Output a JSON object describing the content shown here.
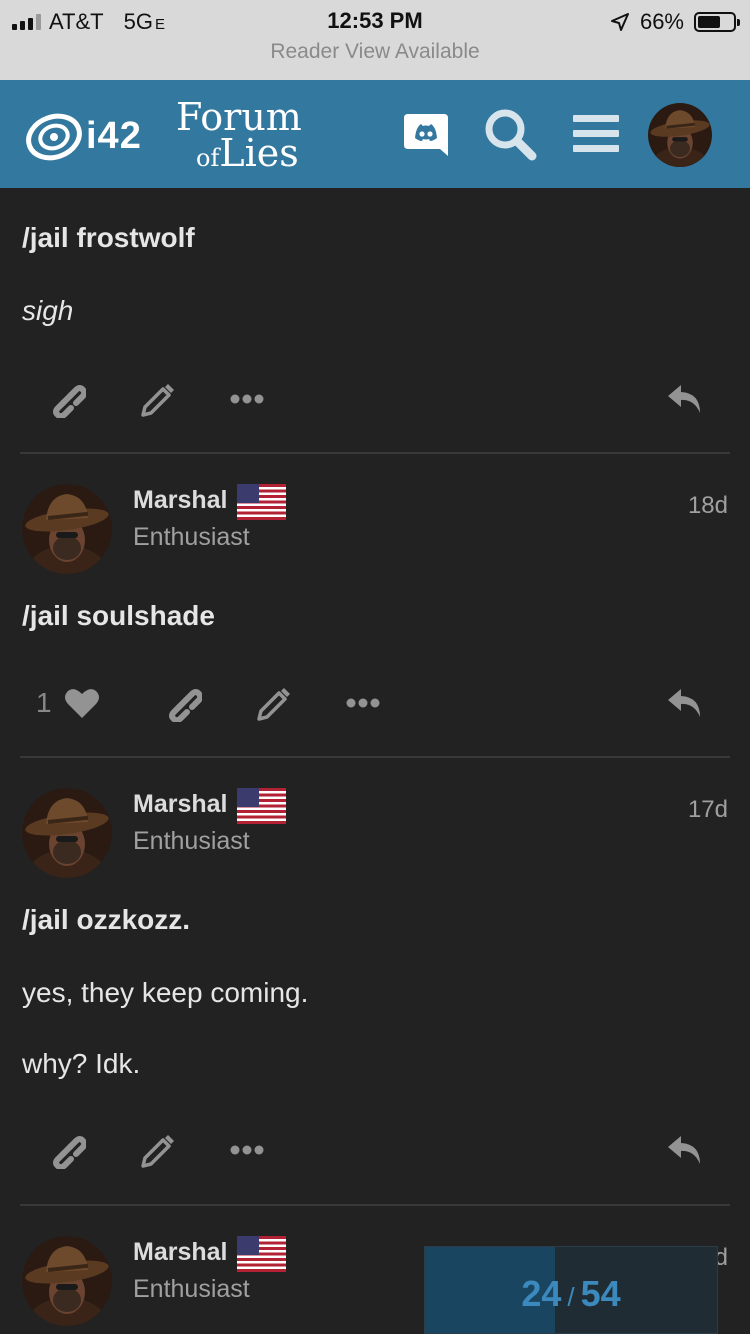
{
  "status_bar": {
    "carrier": "AT&T",
    "network": "5G",
    "network_suffix": "E",
    "time": "12:53 PM",
    "battery": "66%",
    "battery_level": 0.66,
    "reader_view": "Reader View Available"
  },
  "header": {
    "site_logo": "i42",
    "forum_logo_line1": "Forum",
    "forum_logo_line2_small": "of",
    "forum_logo_line2": "Lies",
    "icons": [
      "discord-icon",
      "search-icon",
      "hamburger-menu-icon",
      "user-avatar"
    ]
  },
  "posts": [
    {
      "lines": [
        {
          "text": "/jail frostwolf",
          "style": "bold"
        },
        {
          "text": "sigh",
          "style": "italic"
        }
      ]
    },
    {
      "author": "Marshal",
      "user_title": "Enthusiast",
      "date": "18d",
      "likes": "1",
      "lines": [
        {
          "text": "/jail soulshade",
          "style": "bold"
        }
      ]
    },
    {
      "author": "Marshal",
      "user_title": "Enthusiast",
      "date": "17d",
      "lines": [
        {
          "text": "/jail ozzkozz.",
          "style": "bold"
        },
        {
          "text": "yes, they keep coming.",
          "style": "normal"
        },
        {
          "text": "why? Idk.",
          "style": "normal"
        }
      ]
    },
    {
      "author": "Marshal",
      "user_title": "Enthusiast",
      "date": "d"
    }
  ],
  "timeline": {
    "current": "24",
    "separator": "/",
    "total": "54",
    "progress": 0.444
  },
  "colors": {
    "background": "#222222",
    "header": "#33789e",
    "accent": "#3c89bd"
  }
}
